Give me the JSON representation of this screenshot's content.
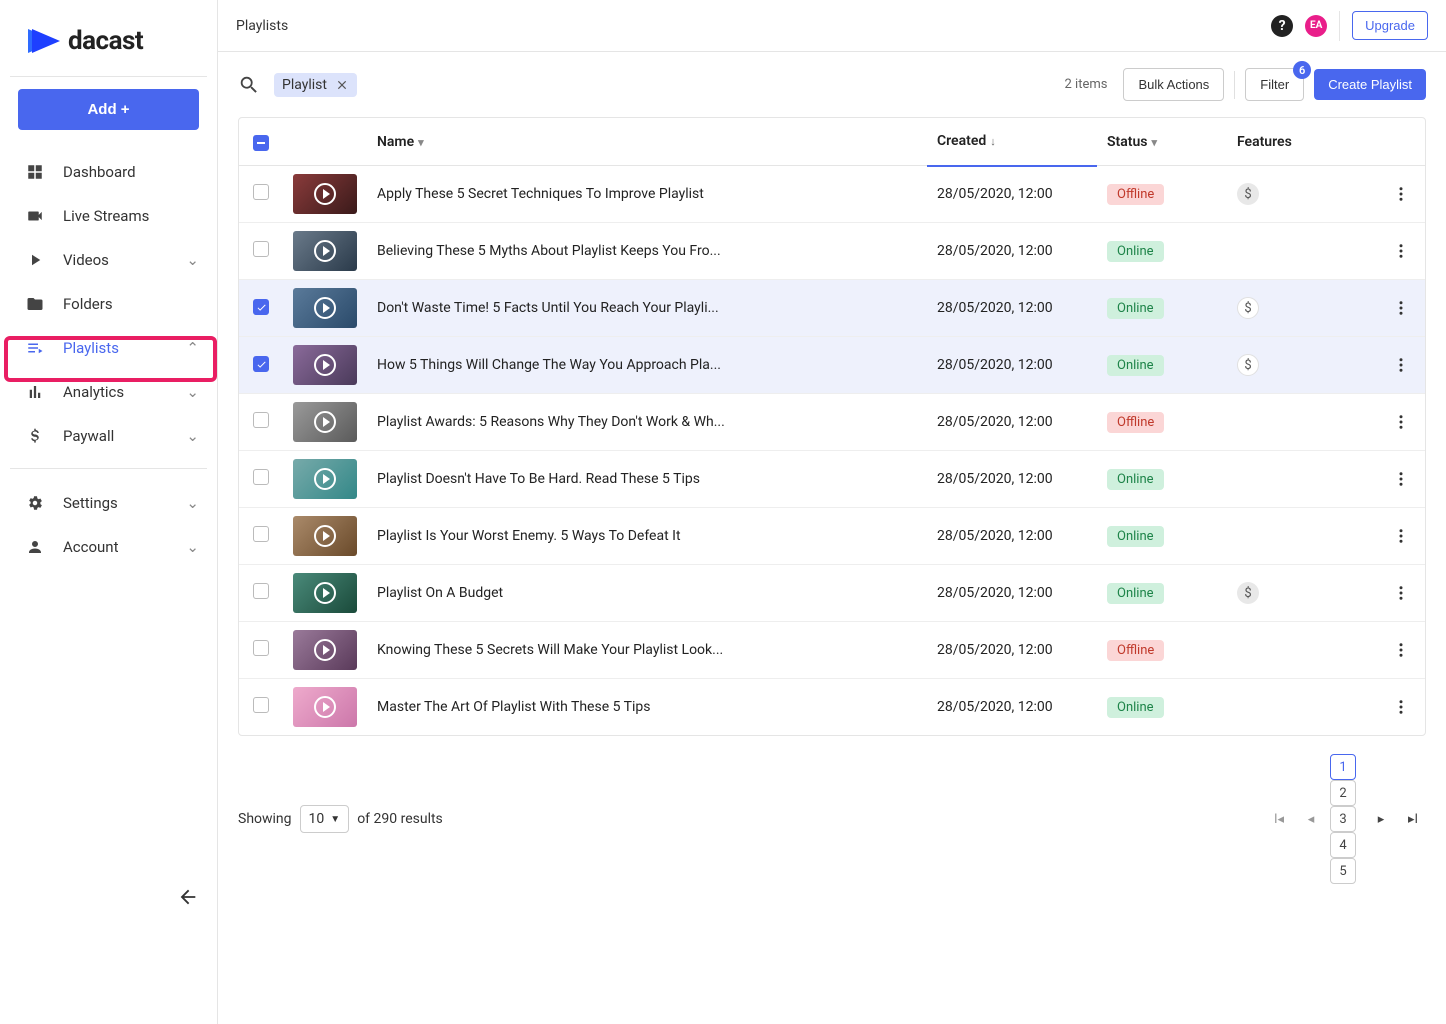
{
  "brand": {
    "name": "dacast"
  },
  "sidebar": {
    "add_label": "Add +",
    "items": [
      {
        "label": "Dashboard",
        "icon": "grid",
        "active": false,
        "chev": null
      },
      {
        "label": "Live Streams",
        "icon": "camcorder",
        "active": false,
        "chev": null
      },
      {
        "label": "Videos",
        "icon": "play-solid",
        "active": false,
        "chev": "down"
      },
      {
        "label": "Folders",
        "icon": "folder",
        "active": false,
        "chev": null
      },
      {
        "label": "Playlists",
        "icon": "playlist",
        "active": true,
        "chev": "up"
      },
      {
        "label": "Analytics",
        "icon": "bars",
        "active": false,
        "chev": "down"
      },
      {
        "label": "Paywall",
        "icon": "dollar",
        "active": false,
        "chev": "down"
      }
    ],
    "items2": [
      {
        "label": "Settings",
        "icon": "gear",
        "chev": "down"
      },
      {
        "label": "Account",
        "icon": "person",
        "chev": "down"
      }
    ]
  },
  "topbar": {
    "title": "Playlists",
    "upgrade": "Upgrade",
    "avatar": "EA"
  },
  "controls": {
    "chip": "Playlist",
    "items_count": "2 items",
    "bulk": "Bulk Actions",
    "filter": "Filter",
    "filter_badge": "6",
    "create": "Create Playlist"
  },
  "table": {
    "headers": {
      "name": "Name",
      "created": "Created",
      "status": "Status",
      "features": "Features"
    },
    "rows": [
      {
        "selected": false,
        "name": "Apply These 5 Secret Techniques To Improve Playlist",
        "created": "28/05/2020, 12:00",
        "status": "Offline",
        "feature": "gray"
      },
      {
        "selected": false,
        "name": "Believing These 5 Myths About Playlist Keeps You Fro...",
        "created": "28/05/2020, 12:00",
        "status": "Online",
        "feature": null
      },
      {
        "selected": true,
        "name": "Don't Waste Time! 5 Facts Until You Reach Your Playli...",
        "created": "28/05/2020, 12:00",
        "status": "Online",
        "feature": "white"
      },
      {
        "selected": true,
        "name": "How 5 Things Will Change The Way You Approach Pla...",
        "created": "28/05/2020, 12:00",
        "status": "Online",
        "feature": "white"
      },
      {
        "selected": false,
        "name": "Playlist Awards: 5 Reasons Why They Don't Work & Wh...",
        "created": "28/05/2020, 12:00",
        "status": "Offline",
        "feature": null
      },
      {
        "selected": false,
        "name": "Playlist Doesn't Have To Be Hard. Read These 5 Tips",
        "created": "28/05/2020, 12:00",
        "status": "Online",
        "feature": null
      },
      {
        "selected": false,
        "name": "Playlist Is Your Worst Enemy. 5 Ways To Defeat It",
        "created": "28/05/2020, 12:00",
        "status": "Online",
        "feature": null
      },
      {
        "selected": false,
        "name": "Playlist On A Budget",
        "created": "28/05/2020, 12:00",
        "status": "Online",
        "feature": "gray"
      },
      {
        "selected": false,
        "name": "Knowing These 5 Secrets Will Make Your Playlist Look...",
        "created": "28/05/2020, 12:00",
        "status": "Offline",
        "feature": null
      },
      {
        "selected": false,
        "name": "Master The Art Of Playlist With These 5 Tips",
        "created": "28/05/2020, 12:00",
        "status": "Online",
        "feature": null
      }
    ]
  },
  "footer": {
    "showing": "Showing",
    "per_page": "10",
    "of_results": "of 290 results",
    "pages": [
      "1",
      "2",
      "3",
      "4",
      "5"
    ],
    "current_page": "1"
  }
}
